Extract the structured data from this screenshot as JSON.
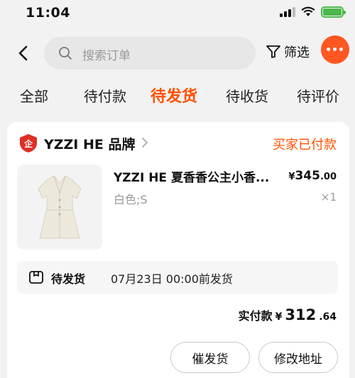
{
  "status_bar": {
    "time": "11:04"
  },
  "header": {
    "search_placeholder": "搜索订单",
    "filter_label": "筛选"
  },
  "tabs": [
    {
      "label": "全部",
      "active": false
    },
    {
      "label": "待付款",
      "active": false
    },
    {
      "label": "待发货",
      "active": true
    },
    {
      "label": "待收货",
      "active": false
    },
    {
      "label": "待评价",
      "active": false
    }
  ],
  "order": {
    "shop_name": "YZZI HE 品牌",
    "status": "买家已付款",
    "product": {
      "title": "YZZI HE 夏香香公主小香...",
      "price_currency": "¥",
      "price_int": "345",
      "price_dec": ".00",
      "spec": "白色;S",
      "qty": "×1"
    },
    "shipping": {
      "label": "待发货",
      "deadline": "07月23日 00:00前发货"
    },
    "paid": {
      "label": "实付款",
      "currency": "¥",
      "int": "312",
      "dec": ".64"
    },
    "buttons": {
      "urge": "催发货",
      "change_address": "修改地址"
    }
  },
  "colors": {
    "accent": "#ff5000",
    "more_button": "#ff5722",
    "battery": "#4bb84b",
    "shop_logo": "#e02e24"
  }
}
